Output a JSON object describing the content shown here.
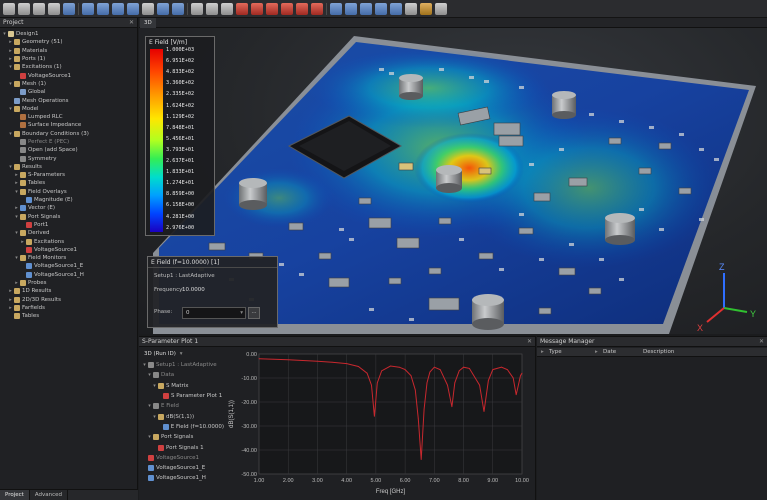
{
  "toolbar": {
    "buttons": [
      {
        "icon": "new-file-icon",
        "color": "g"
      },
      {
        "icon": "open-file-icon",
        "color": "g"
      },
      {
        "icon": "save-icon",
        "color": "g"
      },
      {
        "icon": "save-as-icon",
        "color": "g"
      },
      {
        "icon": "refresh-icon",
        "color": "b"
      },
      {
        "sep": true
      },
      {
        "icon": "document-icon",
        "color": "b"
      },
      {
        "icon": "list-icon",
        "color": "b"
      },
      {
        "icon": "copy-icon",
        "color": "b"
      },
      {
        "icon": "arrow-icon",
        "color": "b"
      },
      {
        "icon": "mesh-icon",
        "color": "g"
      },
      {
        "icon": "node-icon",
        "color": "b"
      },
      {
        "icon": "run-icon",
        "color": "b"
      },
      {
        "sep": true
      },
      {
        "icon": "grid-icon",
        "color": "g"
      },
      {
        "icon": "grid-icon",
        "color": "g"
      },
      {
        "icon": "grid-icon",
        "color": "g"
      },
      {
        "icon": "split-icon",
        "color": "r"
      },
      {
        "icon": "port-icon",
        "color": "r"
      },
      {
        "icon": "port-icon",
        "color": "r"
      },
      {
        "icon": "port-icon",
        "color": "r"
      },
      {
        "icon": "port-icon",
        "color": "r"
      },
      {
        "icon": "port-icon",
        "color": "r"
      },
      {
        "sep": true
      },
      {
        "icon": "report-icon",
        "color": "b"
      },
      {
        "icon": "report-icon",
        "color": "b"
      },
      {
        "icon": "report-icon",
        "color": "b"
      },
      {
        "icon": "report-icon",
        "color": "b"
      },
      {
        "icon": "report-icon",
        "color": "b"
      },
      {
        "icon": "plot-icon",
        "color": "g"
      },
      {
        "icon": "settings-icon",
        "color": "o"
      },
      {
        "icon": "help-icon",
        "color": "g"
      }
    ]
  },
  "project": {
    "title": "Project",
    "close": "✕",
    "tabs": [
      "Project",
      "Advanced"
    ],
    "tree": [
      {
        "d": 0,
        "t": "▾",
        "label": "Design1",
        "c": "#d8c690"
      },
      {
        "d": 1,
        "t": "▸",
        "label": "Geometry (51)",
        "c": "#c8a860"
      },
      {
        "d": 1,
        "t": "▸",
        "label": "Materials",
        "c": "#c8a860"
      },
      {
        "d": 1,
        "t": "▸",
        "label": "Ports (1)",
        "c": "#c8a860"
      },
      {
        "d": 1,
        "t": "▾",
        "label": "Excitations (1)",
        "c": "#c8a860"
      },
      {
        "d": 2,
        "t": "",
        "label": "VoltageSource1",
        "c": "#d04040"
      },
      {
        "d": 1,
        "t": "▾",
        "label": "Mesh (1)",
        "c": "#c8a860"
      },
      {
        "d": 2,
        "t": "",
        "label": "Global",
        "c": "#7c9cc8"
      },
      {
        "d": 1,
        "t": "",
        "label": "Mesh Operations",
        "c": "#7c9cc8"
      },
      {
        "d": 1,
        "t": "▾",
        "label": "Model",
        "c": "#c8a860"
      },
      {
        "d": 2,
        "t": "",
        "label": "Lumped RLC",
        "c": "#b07040"
      },
      {
        "d": 2,
        "t": "",
        "label": "Surface Impedance",
        "c": "#b07040"
      },
      {
        "d": 1,
        "t": "▾",
        "label": "Boundary Conditions (3)",
        "c": "#c8a860"
      },
      {
        "d": 2,
        "t": "",
        "label": "Perfect E (PEC)",
        "c": "#888",
        "dim": true
      },
      {
        "d": 2,
        "t": "",
        "label": "Open    (add Space)",
        "c": "#888"
      },
      {
        "d": 2,
        "t": "",
        "label": "Symmetry",
        "c": "#888"
      },
      {
        "d": 1,
        "t": "▾",
        "label": "Results",
        "c": "#c8a860"
      },
      {
        "d": 2,
        "t": "▸",
        "label": "S-Parameters",
        "c": "#c8a860"
      },
      {
        "d": 2,
        "t": "▸",
        "label": "Tables",
        "c": "#c8a860"
      },
      {
        "d": 2,
        "t": "▾",
        "label": "Field Overlays",
        "c": "#c8a860"
      },
      {
        "d": 3,
        "t": "",
        "label": "Magnitude (E)",
        "c": "#6090d0"
      },
      {
        "d": 2,
        "t": "▸",
        "label": "Vector (E)",
        "c": "#6090d0"
      },
      {
        "d": 2,
        "t": "▾",
        "label": "Port Signals",
        "c": "#c8a860"
      },
      {
        "d": 3,
        "t": "",
        "label": "Port1",
        "c": "#d04040"
      },
      {
        "d": 2,
        "t": "▾",
        "label": "Derived",
        "c": "#c8a860"
      },
      {
        "d": 3,
        "t": "▸",
        "label": "Excitations",
        "c": "#c8a860"
      },
      {
        "d": 3,
        "t": "",
        "label": "VoltageSource1",
        "c": "#d04040"
      },
      {
        "d": 2,
        "t": "▾",
        "label": "Field Monitors",
        "c": "#c8a860"
      },
      {
        "d": 3,
        "t": "",
        "label": "VoltageSource1_E",
        "c": "#6090d0"
      },
      {
        "d": 3,
        "t": "",
        "label": "VoltageSource1_H",
        "c": "#6090d0"
      },
      {
        "d": 2,
        "t": "▸",
        "label": "Probes",
        "c": "#c8a860"
      },
      {
        "d": 1,
        "t": "▸",
        "label": "1D Results",
        "c": "#c8a860"
      },
      {
        "d": 1,
        "t": "▸",
        "label": "2D/3D Results",
        "c": "#c8a860"
      },
      {
        "d": 1,
        "t": "▸",
        "label": "Farfields",
        "c": "#c8a860"
      },
      {
        "d": 1,
        "t": "",
        "label": "Tables",
        "c": "#c8a860"
      }
    ]
  },
  "view": {
    "tab": "3D",
    "legend": {
      "title": "E Field [V/m]",
      "values": [
        "1.000E+03",
        "6.951E+02",
        "4.833E+02",
        "3.360E+02",
        "2.335E+02",
        "1.624E+02",
        "1.129E+02",
        "7.848E+01",
        "5.456E+01",
        "3.793E+01",
        "2.637E+01",
        "1.833E+01",
        "1.274E+01",
        "8.859E+00",
        "6.158E+00",
        "4.281E+00",
        "2.976E+00"
      ]
    },
    "field_panel": {
      "title": "E Field (f=10.0000) [1]",
      "setup_label": "Setup1 : LastAdaptive",
      "frequency_label": "Frequency:",
      "frequency_value": "10.0000",
      "phase_label": "Phase:",
      "phase_value": "0",
      "more_button": "..."
    },
    "axes": {
      "x": "X",
      "y": "Y",
      "z": "Z"
    }
  },
  "sparam": {
    "title": "S-Parameter Plot 1",
    "close": "✕",
    "run_dropdown": "3D (Run ID)",
    "tree": [
      {
        "d": 0,
        "t": "▾",
        "label": "Setup1 : LastAdaptive",
        "c": "#8a8a8a",
        "dim": true
      },
      {
        "d": 1,
        "t": "▾",
        "label": "Data",
        "c": "#888",
        "dim": true
      },
      {
        "d": 2,
        "t": "▾",
        "label": "S Matrix",
        "c": "#c8a860"
      },
      {
        "d": 3,
        "t": "",
        "label": "S Parameter Plot 1",
        "c": "#d04040"
      },
      {
        "d": 1,
        "t": "▾",
        "label": "E Field",
        "c": "#888",
        "dim": true
      },
      {
        "d": 2,
        "t": "▾",
        "label": "dB(S(1,1))",
        "c": "#c8a860"
      },
      {
        "d": 3,
        "t": "",
        "label": "E Field (f=10.0000)",
        "c": "#6090d0"
      },
      {
        "d": 1,
        "t": "▾",
        "label": "Port Signals",
        "c": "#c8a860"
      },
      {
        "d": 2,
        "t": "",
        "label": "Port Signals 1",
        "c": "#d04040"
      },
      {
        "d": 0,
        "t": "",
        "label": "VoltageSource1",
        "c": "#d04040",
        "dim": true
      },
      {
        "d": 0,
        "t": "",
        "label": "VoltageSource1_E",
        "c": "#6090d0"
      },
      {
        "d": 0,
        "t": "",
        "label": "VoltageSource1_H",
        "c": "#6090d0"
      }
    ]
  },
  "chart_data": {
    "type": "line",
    "title": "",
    "xlabel": "Freq [GHz]",
    "ylabel": "dB(S(1,1))",
    "xlim": [
      1.0,
      10.0
    ],
    "ylim": [
      -50.0,
      0.0
    ],
    "xticks": [
      "1.00",
      "2.00",
      "3.00",
      "4.00",
      "5.00",
      "6.00",
      "7.00",
      "8.00",
      "9.00",
      "10.00"
    ],
    "yticks": [
      "0.00",
      "-10.00",
      "-20.00",
      "-30.00",
      "-40.00",
      "-50.00"
    ],
    "grid": true,
    "line_color": "#c8282e",
    "series": [
      {
        "x": [
          1.0,
          1.5,
          2.0,
          2.5,
          3.0,
          3.5,
          4.0,
          4.4,
          4.7,
          4.85,
          4.95,
          5.05,
          5.2,
          5.5,
          5.8,
          6.0,
          6.2,
          6.35,
          6.45,
          6.55,
          6.65,
          6.75,
          6.85,
          7.0,
          7.2,
          7.45,
          7.6,
          7.7,
          7.85,
          8.0,
          8.2,
          8.55,
          8.7,
          8.85,
          9.0,
          9.3,
          9.5,
          9.7,
          9.8,
          9.95,
          10.0
        ],
        "y": [
          -2.0,
          -2.2,
          -2.4,
          -2.7,
          -3.0,
          -3.4,
          -4.0,
          -5.2,
          -8.0,
          -13.0,
          -26.0,
          -12.0,
          -7.0,
          -5.0,
          -5.5,
          -6.5,
          -9.0,
          -15.0,
          -27.0,
          -44.0,
          -23.0,
          -12.0,
          -7.5,
          -5.5,
          -6.5,
          -13.0,
          -22.0,
          -12.0,
          -7.0,
          -5.5,
          -6.0,
          -13.0,
          -24.0,
          -11.0,
          -6.5,
          -5.5,
          -6.5,
          -10.0,
          -17.0,
          -9.0,
          -8.0
        ]
      }
    ]
  },
  "messages": {
    "title": "Message Manager",
    "close": "✕",
    "columns": [
      "Type",
      "Date",
      "Description"
    ]
  }
}
